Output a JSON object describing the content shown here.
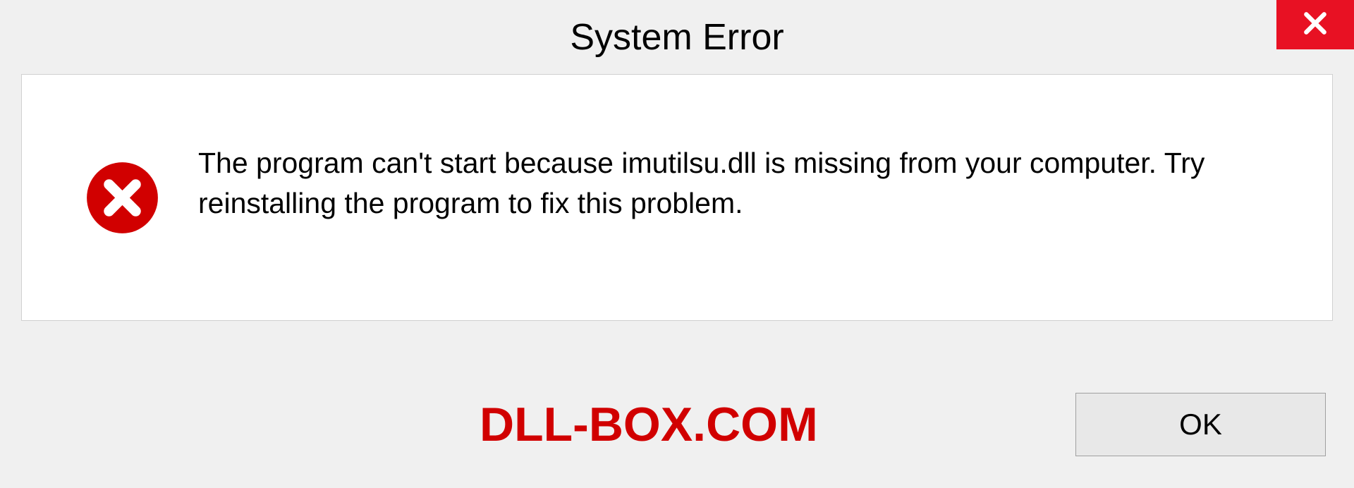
{
  "titlebar": {
    "title": "System Error"
  },
  "dialog": {
    "message": "The program can't start because imutilsu.dll is missing from your computer. Try reinstalling the program to fix this problem."
  },
  "footer": {
    "watermark": "DLL-BOX.COM",
    "ok_label": "OK"
  },
  "colors": {
    "close_bg": "#e81123",
    "error_icon": "#d10000",
    "watermark": "#d10000"
  }
}
